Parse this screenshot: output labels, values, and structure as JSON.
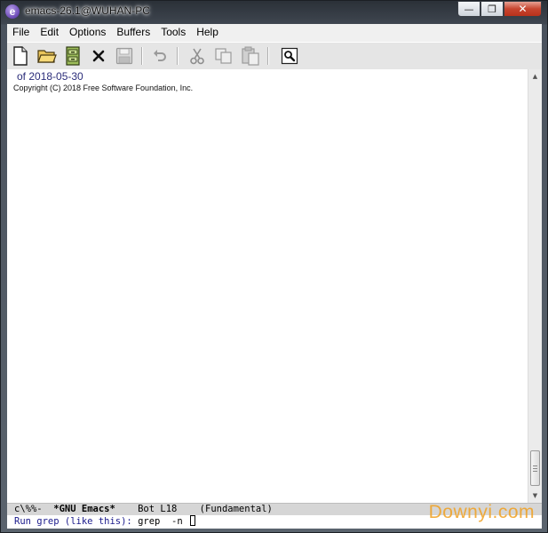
{
  "window": {
    "title": "emacs-26.1@WUHAN-PC",
    "app_icon_glyph": "e",
    "controls": {
      "minimize": "—",
      "maximize": "❐",
      "close": "✕"
    }
  },
  "menubar": {
    "items": [
      {
        "label": "File"
      },
      {
        "label": "Edit"
      },
      {
        "label": "Options"
      },
      {
        "label": "Buffers"
      },
      {
        "label": "Tools"
      },
      {
        "label": "Help"
      }
    ]
  },
  "toolbar": {
    "icons": [
      "new-file-icon",
      "open-folder-icon",
      "dired-cabinet-icon",
      "close-buffer-icon",
      "save-icon",
      "undo-icon",
      "cut-icon",
      "copy-icon",
      "paste-icon",
      "search-icon"
    ]
  },
  "editor": {
    "lines": [
      "of 2018-05-30",
      "Copyright (C) 2018 Free Software Foundation, Inc."
    ]
  },
  "modeline": {
    "status": "c\\%%-",
    "buffer": "*GNU Emacs*",
    "position": "Bot L18",
    "mode": "(Fundamental)"
  },
  "minibuffer": {
    "prompt": "Run grep (like this): ",
    "input": "grep  -n "
  },
  "watermark": "Downyi.com",
  "colors": {
    "title_bar": "#3f4650",
    "menubar": "#f0f0f0",
    "modeline": "#d6d6d6",
    "prompt": "#1a1a8c",
    "watermark": "#f0a020"
  }
}
